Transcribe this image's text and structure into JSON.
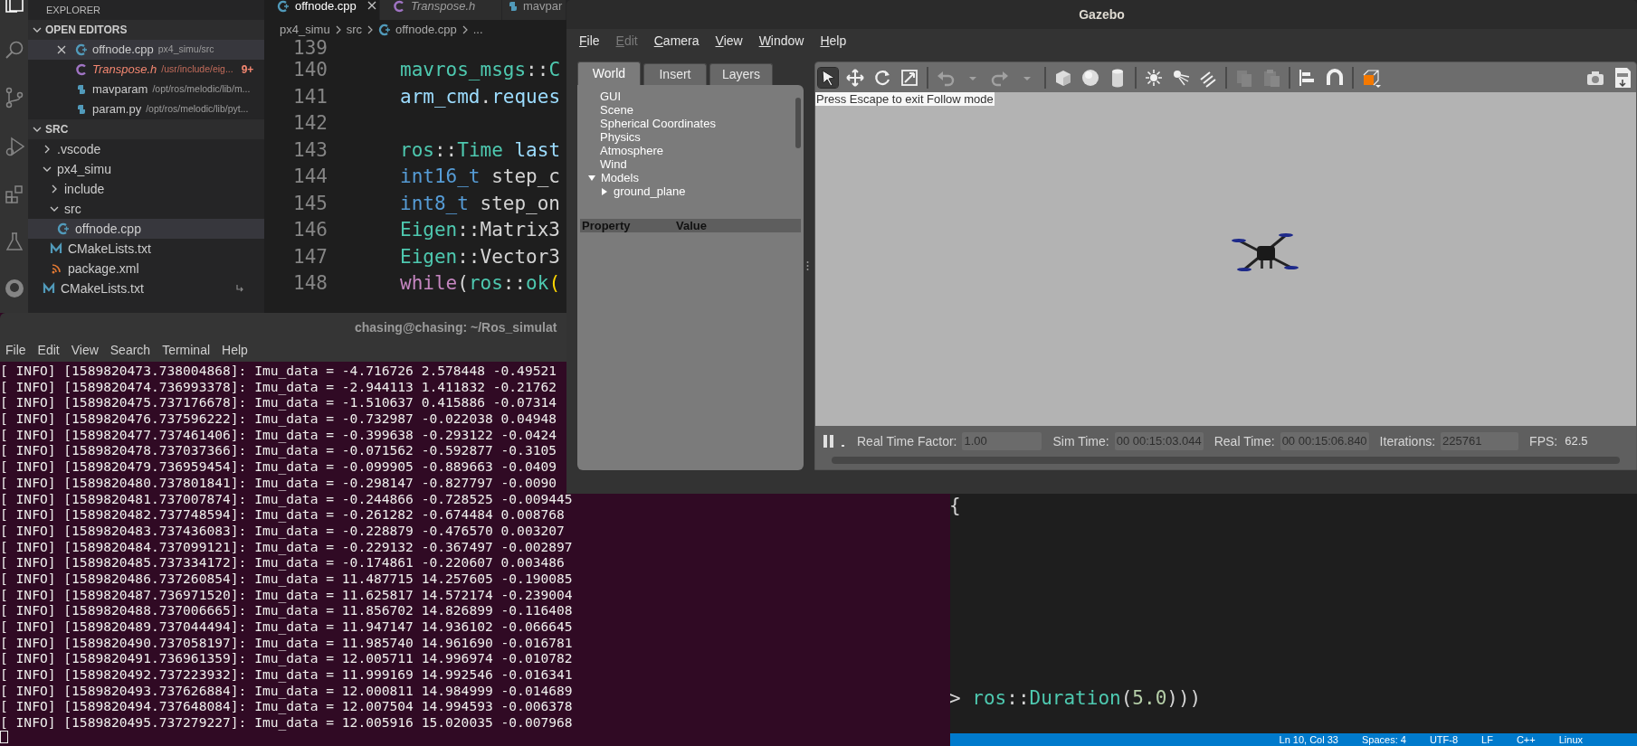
{
  "vscode": {
    "explorer_title": "EXPLORER",
    "open_editors": {
      "title": "OPEN EDITORS",
      "expanded": true,
      "items": [
        {
          "name": "offnode.cpp",
          "path": "px4_simu/src",
          "kind": "cpp",
          "selected": true,
          "preview": false,
          "error": false,
          "closable": true
        },
        {
          "name": "Transpose.h",
          "path": "/usr/include/eig...",
          "kind": "c",
          "selected": false,
          "preview": true,
          "error": true,
          "badge": "9+",
          "closable": false
        },
        {
          "name": "mavparam",
          "path": "/opt/ros/melodic/lib/m...",
          "kind": "python",
          "selected": false,
          "preview": false,
          "error": false,
          "closable": false
        },
        {
          "name": "param.py",
          "path": "/opt/ros/melodic/lib/pyt...",
          "kind": "python",
          "selected": false,
          "preview": false,
          "error": false,
          "closable": false
        }
      ]
    },
    "folder": {
      "title": "SRC",
      "expanded": true,
      "tree": [
        {
          "name": ".vscode",
          "kind": "folder",
          "expanded": false,
          "selected": false
        },
        {
          "name": "px4_simu",
          "kind": "folder",
          "expanded": true,
          "selected": false,
          "children": [
            {
              "name": "include",
              "kind": "folder",
              "expanded": false,
              "selected": false
            },
            {
              "name": "src",
              "kind": "folder",
              "expanded": true,
              "selected": false,
              "children": [
                {
                  "name": "offnode.cpp",
                  "kind": "cpp",
                  "selected": true
                }
              ]
            },
            {
              "name": "CMakeLists.txt",
              "kind": "cmake",
              "selected": false
            },
            {
              "name": "package.xml",
              "kind": "rss",
              "selected": false
            }
          ]
        },
        {
          "name": "CMakeLists.txt",
          "kind": "cmake",
          "selected": false,
          "linked": true
        }
      ]
    },
    "tabs": [
      {
        "label": "offnode.cpp",
        "kind": "cpp",
        "selected": true,
        "preview": false
      },
      {
        "label": "Transpose.h",
        "kind": "c",
        "selected": false,
        "preview": true
      },
      {
        "label": "mavpar",
        "kind": "python",
        "selected": false,
        "preview": false
      }
    ],
    "breadcrumb": [
      {
        "text": "px4_simu"
      },
      {
        "text": "src"
      },
      {
        "text": "offnode.cpp",
        "kind": "cpp"
      },
      {
        "text": "..."
      }
    ],
    "code": [
      {
        "number": "139"
      },
      {
        "number": "140",
        "tokens": [
          {
            "t": "mavros_msgs",
            "kind": "type"
          },
          {
            "t": "::",
            "kind": "plain"
          },
          {
            "t": "C",
            "kind": "type"
          }
        ]
      },
      {
        "number": "141",
        "tokens": [
          {
            "t": "arm_cmd",
            "kind": "var"
          },
          {
            "t": ".",
            "kind": "plain"
          },
          {
            "t": "reques",
            "kind": "var"
          }
        ]
      },
      {
        "number": "142"
      },
      {
        "number": "143",
        "tokens": [
          {
            "t": "ros",
            "kind": "type"
          },
          {
            "t": "::",
            "kind": "plain"
          },
          {
            "t": "Time",
            "kind": "type"
          },
          {
            "t": " last",
            "kind": "var"
          }
        ]
      },
      {
        "number": "144",
        "tokens": [
          {
            "t": "int16_t",
            "kind": "keyword"
          },
          {
            "t": " step_c",
            "kind": "plain"
          }
        ]
      },
      {
        "number": "145",
        "tokens": [
          {
            "t": "int8_t",
            "kind": "keyword"
          },
          {
            "t": " step_on",
            "kind": "plain"
          }
        ]
      },
      {
        "number": "146",
        "tokens": [
          {
            "t": "Eigen",
            "kind": "type"
          },
          {
            "t": "::Matrix3",
            "kind": "plain"
          }
        ]
      },
      {
        "number": "147",
        "tokens": [
          {
            "t": "Eigen",
            "kind": "type"
          },
          {
            "t": "::Vector3",
            "kind": "plain"
          }
        ]
      },
      {
        "number": "148",
        "tokens": [
          {
            "t": "while",
            "kind": "control"
          },
          {
            "t": "(",
            "kind": "plain"
          },
          {
            "t": "ros",
            "kind": "type"
          },
          {
            "t": "::",
            "kind": "plain"
          },
          {
            "t": "ok",
            "kind": "type"
          },
          {
            "t": "(",
            "kind": "bracket"
          }
        ]
      }
    ],
    "lower_code": [
      {
        "tokens": [
          {
            "t": "{",
            "kind": "plain"
          }
        ]
      },
      {
        "tokens": [
          {
            "t": "> ",
            "kind": "plain"
          },
          {
            "t": "ros",
            "kind": "type"
          },
          {
            "t": "::",
            "kind": "plain"
          },
          {
            "t": "Duration",
            "kind": "type"
          },
          {
            "t": "(",
            "kind": "plain"
          },
          {
            "t": "5.0",
            "kind": "number"
          },
          {
            "t": ")))",
            "kind": "plain"
          }
        ]
      }
    ],
    "status_bar": [
      "Ln 10, Col 33",
      "Spaces: 4",
      "UTF-8",
      "LF",
      "C++",
      "Linux"
    ]
  },
  "terminal": {
    "title": "chasing@chasing: ~/Ros_simulat",
    "menu": [
      "File",
      "Edit",
      "View",
      "Search",
      "Terminal",
      "Help"
    ],
    "lines": [
      "[ INFO] [1589820473.738004868]: Imu_data = -4.716726 2.578448 -0.49521",
      "[ INFO] [1589820474.736993378]: Imu_data = -2.944113 1.411832 -0.21762",
      "[ INFO] [1589820475.737176678]: Imu_data = -1.510637 0.415886 -0.07314",
      "[ INFO] [1589820476.737596222]: Imu_data = -0.732987 -0.022038 0.04948",
      "[ INFO] [1589820477.737461406]: Imu_data = -0.399638 -0.293122 -0.0424",
      "[ INFO] [1589820478.737037366]: Imu_data = -0.071562 -0.592877 -0.3105",
      "[ INFO] [1589820479.736959454]: Imu_data = -0.099905 -0.889663 -0.0409",
      "[ INFO] [1589820480.737801841]: Imu_data = -0.298147 -0.827797 -0.0090",
      "[ INFO] [1589820481.737007874]: Imu_data = -0.244866 -0.728525 -0.009445",
      "[ INFO] [1589820482.737748594]: Imu_data = -0.261282 -0.674484 0.008768",
      "[ INFO] [1589820483.737436083]: Imu_data = -0.228879 -0.476570 0.003207",
      "[ INFO] [1589820484.737099121]: Imu_data = -0.229132 -0.367497 -0.002897",
      "[ INFO] [1589820485.737334172]: Imu_data = -0.174861 -0.220607 0.003486",
      "[ INFO] [1589820486.737260854]: Imu_data = 11.487715 14.257605 -0.190085",
      "[ INFO] [1589820487.736971520]: Imu_data = 11.625817 14.572174 -0.239004",
      "[ INFO] [1589820488.737006665]: Imu_data = 11.856702 14.826899 -0.116408",
      "[ INFO] [1589820489.737044494]: Imu_data = 11.947147 14.936102 -0.066645",
      "[ INFO] [1589820490.737058197]: Imu_data = 11.985740 14.961690 -0.016781",
      "[ INFO] [1589820491.736961359]: Imu_data = 12.005711 14.996974 -0.010782",
      "[ INFO] [1589820492.737223932]: Imu_data = 11.999169 14.992546 -0.016341",
      "[ INFO] [1589820493.737626884]: Imu_data = 12.000811 14.984999 -0.014689",
      "[ INFO] [1589820494.737648084]: Imu_data = 12.007504 14.994593 -0.006378",
      "[ INFO] [1589820495.737279227]: Imu_data = 12.005916 15.020035 -0.007968"
    ]
  },
  "gazebo": {
    "title": "Gazebo",
    "menu": [
      {
        "label": "File",
        "disabled": false
      },
      {
        "label": "Edit",
        "disabled": true
      },
      {
        "label": "Camera",
        "disabled": false
      },
      {
        "label": "View",
        "disabled": false
      },
      {
        "label": "Window",
        "disabled": false
      },
      {
        "label": "Help",
        "disabled": false
      }
    ],
    "panel_tabs": [
      {
        "label": "World",
        "selected": true
      },
      {
        "label": "Insert",
        "selected": false
      },
      {
        "label": "Layers",
        "selected": false
      }
    ],
    "world_tree": [
      {
        "label": "GUI"
      },
      {
        "label": "Scene"
      },
      {
        "label": "Spherical Coordinates"
      },
      {
        "label": "Physics"
      },
      {
        "label": "Atmosphere"
      },
      {
        "label": "Wind"
      },
      {
        "label": "Models",
        "expanded": true,
        "children": [
          {
            "label": "ground_plane",
            "expanded": false
          }
        ]
      }
    ],
    "property_header": [
      "Property",
      "Value"
    ],
    "tools": [
      {
        "selected": true,
        "disabled": false
      },
      {
        "selected": false,
        "disabled": false
      },
      {
        "selected": false,
        "disabled": false
      },
      {
        "selected": false,
        "disabled": false
      },
      {
        "selected": false,
        "disabled": true
      },
      {
        "selected": false,
        "disabled": true
      },
      {
        "selected": false,
        "disabled": true
      },
      {
        "selected": false,
        "disabled": true
      },
      {
        "selected": false,
        "disabled": false
      },
      {
        "selected": false,
        "disabled": false
      },
      {
        "selected": false,
        "disabled": false
      },
      {
        "selected": false,
        "disabled": false
      },
      {
        "selected": false,
        "disabled": false
      },
      {
        "selected": false,
        "disabled": false
      },
      {
        "selected": false,
        "disabled": true
      },
      {
        "selected": false,
        "disabled": true
      },
      {
        "selected": false,
        "disabled": false
      },
      {
        "selected": false,
        "disabled": false
      },
      {
        "selected": false,
        "disabled": false
      }
    ],
    "notice": "Press Escape to exit Follow mode",
    "stats": [
      {
        "label": "Real Time Factor:",
        "value": "1.00"
      },
      {
        "label": "Sim Time:",
        "value": "00 00:15:03.044"
      },
      {
        "label": "Real Time:",
        "value": "00 00:15:06.840"
      },
      {
        "label": "Iterations:",
        "value": "225761"
      },
      {
        "label": "FPS:",
        "value": "62.5"
      }
    ]
  }
}
